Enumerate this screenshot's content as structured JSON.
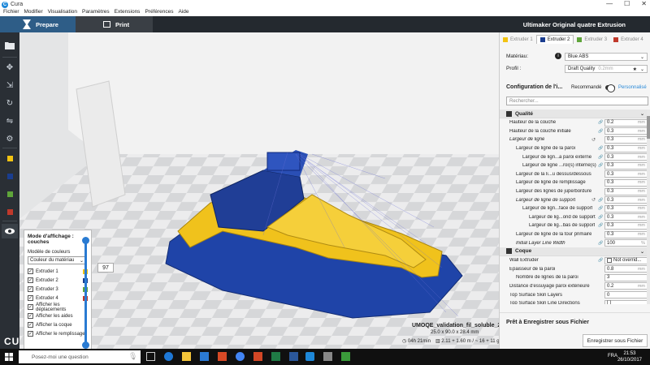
{
  "window": {
    "title": "Cura",
    "logo_letter": "C",
    "controls": [
      "—",
      "☐",
      "✕"
    ]
  },
  "menu": [
    "Fichier",
    "Modifier",
    "Visualisation",
    "Paramètres",
    "Extensions",
    "Préférences",
    "Aide"
  ],
  "header": {
    "tab_prepare": "Prepare",
    "tab_print": "Print",
    "printer": "Ultimaker Original quatre Extrusion"
  },
  "extruders": [
    {
      "label": "Extruder 1",
      "color": "#f2c312"
    },
    {
      "label": "Extruder 2",
      "color": "#1a3d8f"
    },
    {
      "label": "Extruder 3",
      "color": "#5fa53a"
    },
    {
      "label": "Extruder 4",
      "color": "#c0392b"
    }
  ],
  "material": {
    "label": "Matériau:",
    "value": "Blue ABS"
  },
  "profile": {
    "label": "Profil :",
    "value": "Draft Quality",
    "layer": "0.2mm"
  },
  "config": {
    "title": "Configuration de l'i...",
    "recommended": "Recommandé",
    "custom": "Personnalisé",
    "search_placeholder": "Rechercher..."
  },
  "settings": {
    "quality_header": "Qualité",
    "quality_rows": [
      {
        "label": "Hauteur de la couche",
        "value": "0.2",
        "unit": "mm",
        "indent": 12,
        "icons": "link"
      },
      {
        "label": "Hauteur de la couche initiale",
        "value": "0.3",
        "unit": "mm",
        "indent": 12,
        "icons": "link"
      },
      {
        "label": "Largeur de ligne",
        "value": "0.3",
        "unit": "mm",
        "indent": 12,
        "italic": true,
        "icons": "reset-info"
      },
      {
        "label": "Largeur de ligne de la paroi",
        "value": "0.3",
        "unit": "mm",
        "indent": 20,
        "icons": "link"
      },
      {
        "label": "Largeur de lign...a paroi externe",
        "value": "0.3",
        "unit": "mm",
        "indent": 28,
        "icons": "link"
      },
      {
        "label": "Largeur de ligne ...roi(s) interne(s)",
        "value": "0.3",
        "unit": "mm",
        "indent": 28,
        "icons": "link"
      },
      {
        "label": "Largeur de la li...u dessus/dessous",
        "value": "0.3",
        "unit": "mm",
        "indent": 20,
        "icons": ""
      },
      {
        "label": "Largeur de ligne de remplissage",
        "value": "0.3",
        "unit": "mm",
        "indent": 20,
        "icons": ""
      },
      {
        "label": "Largeur des lignes de jupe/bordure",
        "value": "0.3",
        "unit": "mm",
        "indent": 20,
        "icons": ""
      },
      {
        "label": "Largeur de ligne de support",
        "value": "0.3",
        "unit": "mm",
        "indent": 20,
        "italic": true,
        "icons": "link-reset-info"
      },
      {
        "label": "Largeur de lign...face de support",
        "value": "0.3",
        "unit": "mm",
        "indent": 28,
        "icons": "link"
      },
      {
        "label": "Largeur de lig...ond de support",
        "value": "0.3",
        "unit": "mm",
        "indent": 36,
        "icons": "link"
      },
      {
        "label": "Largeur de lig...bas de support",
        "value": "0.3",
        "unit": "mm",
        "indent": 36,
        "icons": "link"
      },
      {
        "label": "Largeur de ligne de la tour primaire",
        "value": "0.3",
        "unit": "mm",
        "indent": 20,
        "icons": ""
      },
      {
        "label": "Initial Layer Line Width",
        "value": "100",
        "unit": "%",
        "indent": 20,
        "italic": true,
        "icons": "link"
      }
    ],
    "shell_header": "Coque",
    "shell_rows": [
      {
        "label": "Wall Extruder",
        "value": "Not overrid...",
        "unit": "",
        "indent": 12,
        "icons": "link",
        "check": true
      },
      {
        "label": "Épaisseur de la paroi",
        "value": "0.8",
        "unit": "mm",
        "indent": 12,
        "icons": ""
      },
      {
        "label": "Nombre de lignes de la paroi",
        "value": "3",
        "unit": "",
        "indent": 20,
        "icons": ""
      },
      {
        "label": "Distance d'essuyage paroi extérieure",
        "value": "0.2",
        "unit": "mm",
        "indent": 12,
        "icons": ""
      },
      {
        "label": "Top Surface Skin Layers",
        "value": "0",
        "unit": "",
        "indent": 12,
        "icons": ""
      },
      {
        "label": "Top Surface Skin Line Directions",
        "value": "[ ]",
        "unit": "",
        "indent": 12,
        "icons": ""
      }
    ]
  },
  "save": {
    "title": "Prêt à Enregistrer sous Fichier",
    "button": "Enregistrer sous Fichier"
  },
  "job": {
    "name": "UMOQE_validation_fil_soluble_2",
    "dims": "25.0 x 90.0 x 28.4 mm",
    "time": "04h 21min",
    "material": "2.11 + 1.60 m / ~ 16 + 11 g"
  },
  "viewmode": {
    "title": "Mode d'affichage : couches",
    "color_model_label": "Modèle de couleurs",
    "color_model_value": "Couleur du matériau",
    "extruder_rows": [
      "Extruder 1",
      "Extruder 2",
      "Extruder 3",
      "Extruder 4"
    ],
    "options": [
      "Afficher les déplacements",
      "Afficher les aides",
      "Afficher la coque",
      "Afficher le remplissage"
    ],
    "layer_value": "97"
  },
  "brand": "CU",
  "taskbar": {
    "search_placeholder": "Posez-moi une question",
    "lang": "FRA",
    "time": "21:53",
    "date": "26/10/2017"
  }
}
